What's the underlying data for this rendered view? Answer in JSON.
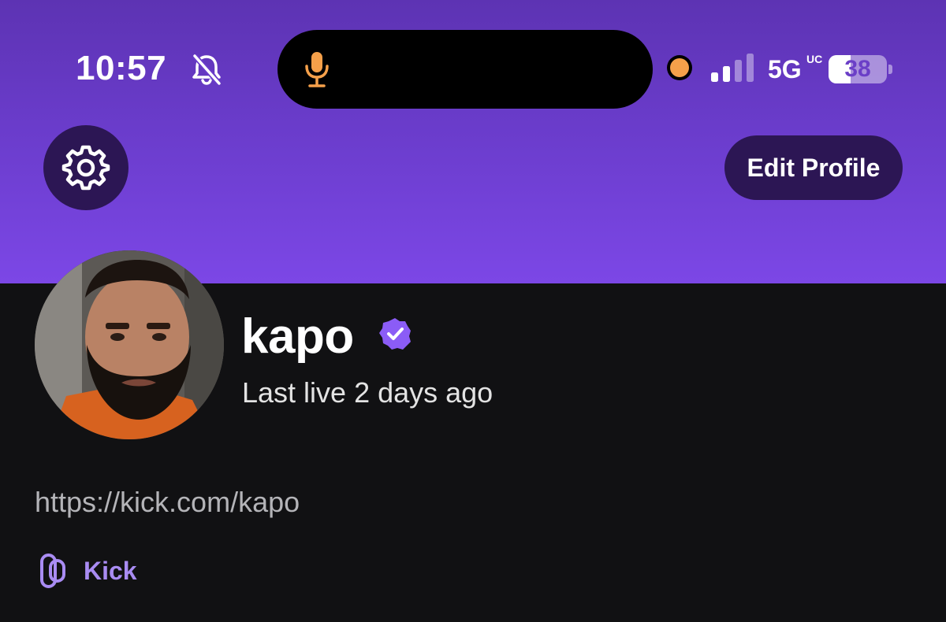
{
  "status_bar": {
    "time": "10:57",
    "network": "5G",
    "network_superscript": "UC",
    "battery_level": "38",
    "battery_fraction": 0.38,
    "icons": [
      "bell-slash-icon",
      "microphone-icon",
      "recording-dot-icon",
      "cellular-signal-icon",
      "battery-icon"
    ]
  },
  "header": {
    "settings_icon": "gear-icon",
    "edit_profile_label": "Edit Profile",
    "gradient_colors": [
      "#5d33b3",
      "#7c47e6"
    ]
  },
  "profile": {
    "username": "kapo",
    "verified": true,
    "last_live": "Last live 2 days ago",
    "url": "https://kick.com/kapo",
    "links": [
      {
        "label": "Kick",
        "icon": "link-icon"
      }
    ]
  },
  "colors": {
    "accent": "#a98cf3",
    "background": "#111113",
    "verified_badge": "#8b5cf6",
    "button_bg": "#2c1654"
  }
}
